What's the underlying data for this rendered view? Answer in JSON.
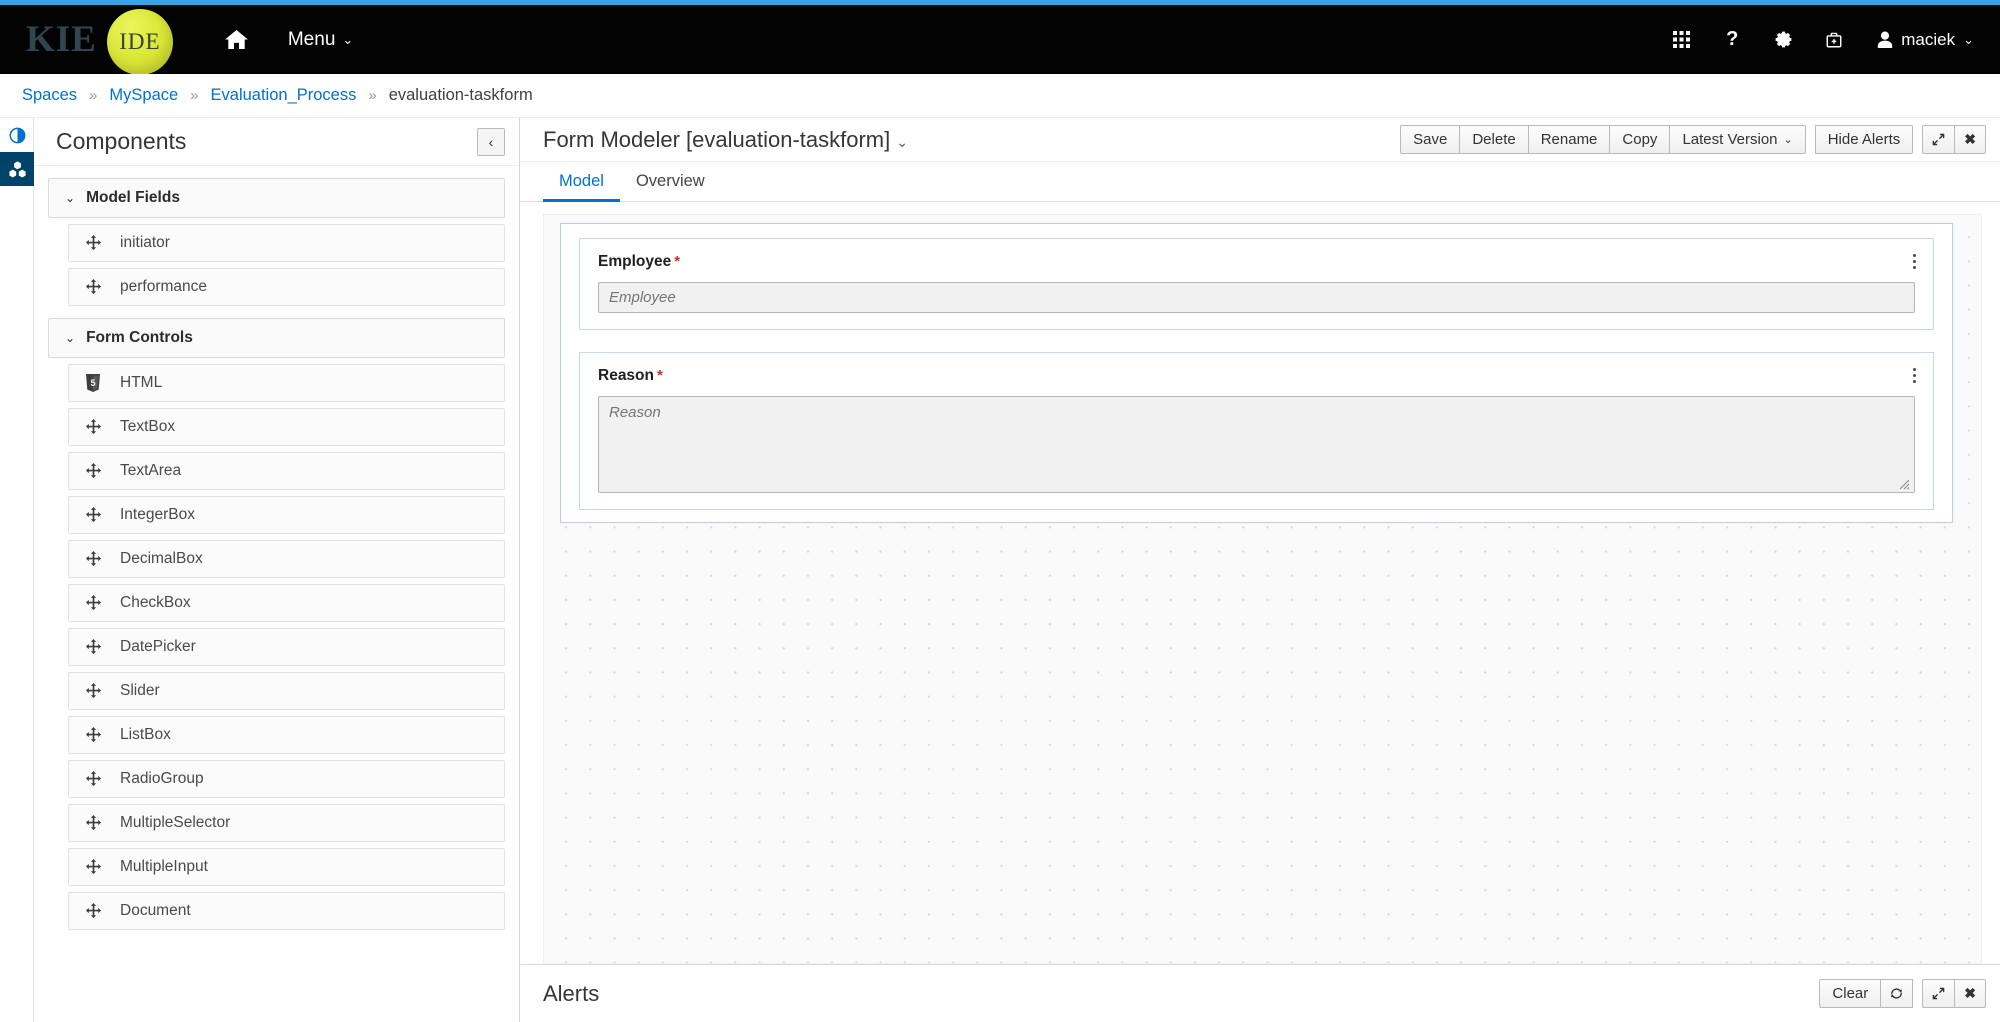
{
  "masthead": {
    "brand_primary": "KIE",
    "brand_secondary": "IDE",
    "home_icon": "home-icon",
    "menu_label": "Menu",
    "icons": [
      {
        "name": "apps-grid-icon",
        "glyph": "grid"
      },
      {
        "name": "help-icon",
        "glyph": "?"
      },
      {
        "name": "settings-gear-icon",
        "glyph": "gear"
      },
      {
        "name": "toolkit-icon",
        "glyph": "kit"
      }
    ],
    "user_name": "maciek",
    "accent_color": "#39a5dc",
    "background_color": "#030303"
  },
  "breadcrumb": {
    "separator": "»",
    "items": [
      {
        "label": "Spaces",
        "link": true
      },
      {
        "label": "MySpace",
        "link": true
      },
      {
        "label": "Evaluation_Process",
        "link": true
      },
      {
        "label": "evaluation-taskform",
        "link": false
      }
    ],
    "link_color": "#0071ce"
  },
  "rail": {
    "items": [
      {
        "name": "contrast-icon",
        "active": false
      },
      {
        "name": "cubes-icon",
        "active": true
      }
    ],
    "active_color": "#004368"
  },
  "panel": {
    "title": "Components",
    "collapse_label": "‹",
    "groups": [
      {
        "title": "Model Fields",
        "caret": "⌄",
        "items": [
          {
            "label": "initiator",
            "icon": "move-icon"
          },
          {
            "label": "performance",
            "icon": "move-icon"
          }
        ]
      },
      {
        "title": "Form Controls",
        "caret": "⌄",
        "items": [
          {
            "label": "HTML",
            "icon": "html5-icon"
          },
          {
            "label": "TextBox",
            "icon": "move-icon"
          },
          {
            "label": "TextArea",
            "icon": "move-icon"
          },
          {
            "label": "IntegerBox",
            "icon": "move-icon"
          },
          {
            "label": "DecimalBox",
            "icon": "move-icon"
          },
          {
            "label": "CheckBox",
            "icon": "move-icon"
          },
          {
            "label": "DatePicker",
            "icon": "move-icon"
          },
          {
            "label": "Slider",
            "icon": "move-icon"
          },
          {
            "label": "ListBox",
            "icon": "move-icon"
          },
          {
            "label": "RadioGroup",
            "icon": "move-icon"
          },
          {
            "label": "MultipleSelector",
            "icon": "move-icon"
          },
          {
            "label": "MultipleInput",
            "icon": "move-icon"
          },
          {
            "label": "Document",
            "icon": "move-icon"
          }
        ]
      }
    ]
  },
  "editor": {
    "title": "Form Modeler [evaluation-taskform]",
    "title_caret": "⌄",
    "toolbar": {
      "save": "Save",
      "delete": "Delete",
      "rename": "Rename",
      "copy": "Copy",
      "version": "Latest Version",
      "version_caret": "⌄",
      "hide_alerts": "Hide Alerts",
      "maximize_icon": "expand-diagonal-icon",
      "close_icon": "close-icon"
    },
    "tabs": [
      {
        "label": "Model",
        "active": true
      },
      {
        "label": "Overview",
        "active": false
      }
    ],
    "active_tab_color": "#0071ce"
  },
  "form": {
    "fields": [
      {
        "label": "Employee",
        "required": true,
        "required_mark": "*",
        "control": "input",
        "placeholder": "Employee",
        "value": ""
      },
      {
        "label": "Reason",
        "required": true,
        "required_mark": "*",
        "control": "textarea",
        "placeholder": "Reason",
        "value": ""
      }
    ],
    "kebab_icon": "kebab-menu-icon"
  },
  "alerts": {
    "title": "Alerts",
    "clear_label": "Clear",
    "refresh_icon": "refresh-icon",
    "maximize_icon": "expand-diagonal-icon",
    "close_icon": "close-icon"
  }
}
